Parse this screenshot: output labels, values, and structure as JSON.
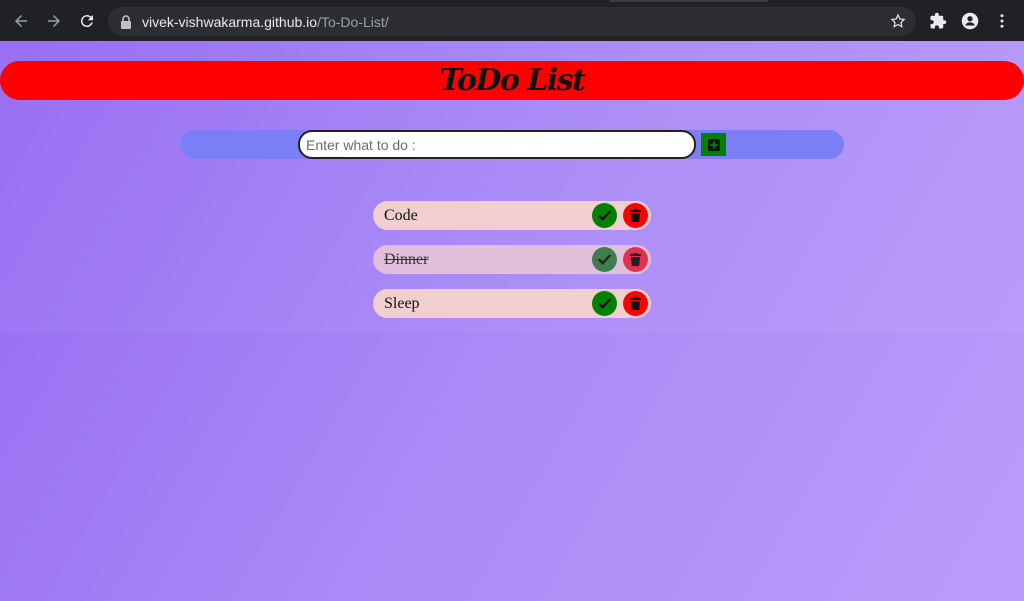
{
  "browser": {
    "url_host": "vivek-vishwakarma.github.io",
    "url_path": "/To-Do-List/"
  },
  "header": {
    "title": "ToDo List"
  },
  "input": {
    "placeholder": "Enter what to do :",
    "value": ""
  },
  "todos": [
    {
      "label": "Code",
      "done": false
    },
    {
      "label": "Dinner",
      "done": true
    },
    {
      "label": "Sleep",
      "done": false
    }
  ],
  "colors": {
    "header_bg": "#ff0000",
    "input_bar_bg": "#7a7ff6",
    "item_bg": "#f2cfcf",
    "check_bg": "#008000",
    "trash_bg": "#ff0000",
    "add_bg": "#008000"
  }
}
